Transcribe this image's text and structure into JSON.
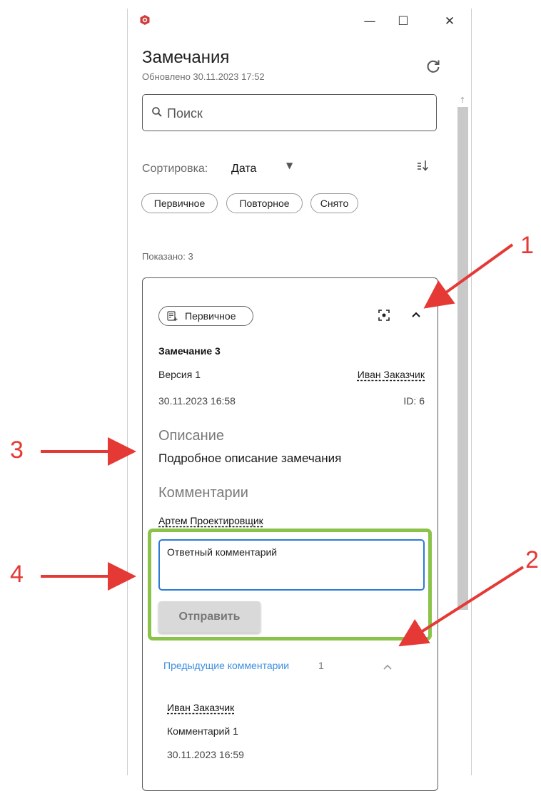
{
  "window": {
    "minimize_glyph": "—",
    "maximize_glyph": "☐",
    "close_glyph": "✕"
  },
  "header": {
    "title": "Замечания",
    "updated": "Обновлено 30.11.2023 17:52"
  },
  "search": {
    "placeholder": "Поиск"
  },
  "sort": {
    "label": "Сортировка:",
    "value": "Дата",
    "caret": "▼"
  },
  "filters": [
    "Первичное",
    "Повторное",
    "Снято"
  ],
  "shown": "Показано: 3",
  "card": {
    "status": "Первичное",
    "title": "Замечание 3",
    "version": "Версия 1",
    "author": "Иван Заказчик",
    "date": "30.11.2023 16:58",
    "id": "ID: 6",
    "description_heading": "Описание",
    "description": "Подробное описание замечания",
    "comments_heading": "Комментарии",
    "current_user": "Артем Проектировщик",
    "reply_value": "Ответный комментарий",
    "send_label": "Отправить",
    "previous_label": "Предыдущие комментарии",
    "previous_count": "1",
    "previous": {
      "author": "Иван Заказчик",
      "text": "Комментарий 1",
      "date": "30.11.2023 16:59"
    }
  },
  "annotations": {
    "n1": "1",
    "n2": "2",
    "n3": "3",
    "n4": "4",
    "color": "#e53935"
  },
  "colors": {
    "accent": "#2b7bd6",
    "link": "#3d8fe0",
    "highlight": "#8bc34a"
  }
}
